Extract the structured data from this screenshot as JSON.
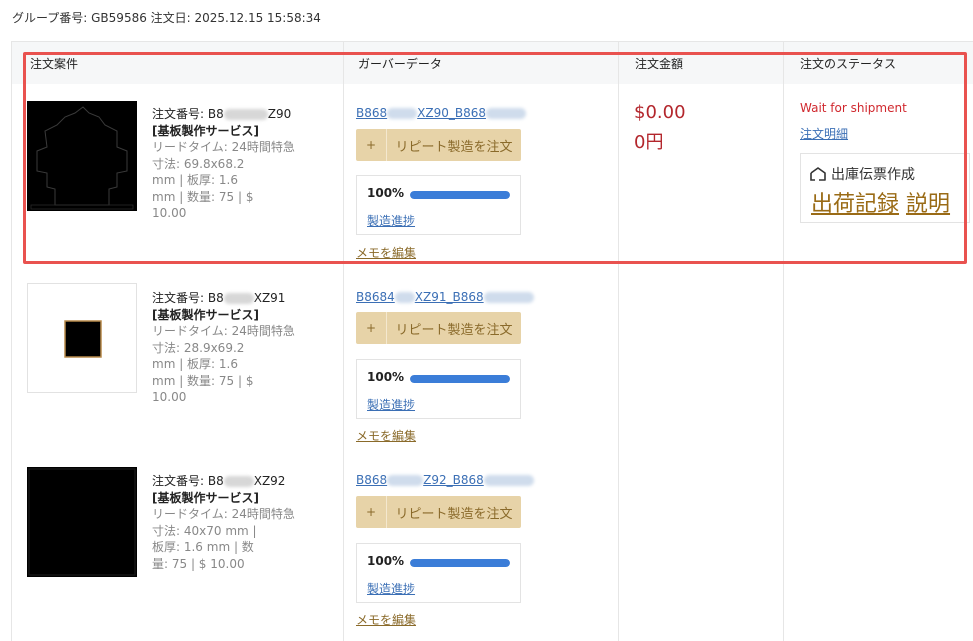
{
  "group": {
    "label": "グループ番号: GB59586 注文日: 2025.12.15 15:58:34"
  },
  "headers": {
    "case": "注文案件",
    "gerber": "ガーバーデータ",
    "amount": "注文金額",
    "status": "注文のステータス"
  },
  "items": [
    {
      "order_prefix": "注文番号: B8",
      "order_suffix": "Z90",
      "service": "[基板製作サービス]",
      "details": [
        "リードタイム: 24時間特急",
        "寸法: 69.8x68.2",
        "mm | 板厚: 1.6",
        "mm | 数量: 75 | $",
        "10.00"
      ],
      "gerber_prefix": "B868",
      "gerber_mid": "XZ90_B868",
      "repeat_plus": "+",
      "repeat_label": "リピート製造を注文",
      "progress_pct": "100%",
      "progress_value": 100,
      "progress_link": "製造進捗",
      "memo": "メモを編集"
    },
    {
      "order_prefix": "注文番号: B8",
      "order_suffix": "XZ91",
      "service": "[基板製作サービス]",
      "details": [
        "リードタイム: 24時間特急",
        "寸法: 28.9x69.2",
        "mm | 板厚: 1.6",
        "mm | 数量: 75 | $",
        "10.00"
      ],
      "gerber_prefix": "B8684",
      "gerber_mid": "XZ91_B868",
      "repeat_plus": "+",
      "repeat_label": "リピート製造を注文",
      "progress_pct": "100%",
      "progress_value": 100,
      "progress_link": "製造進捗",
      "memo": "メモを編集"
    },
    {
      "order_prefix": "注文番号: B8",
      "order_suffix": "XZ92",
      "service": "[基板製作サービス]",
      "details": [
        "リードタイム: 24時間特急",
        "寸法: 40x70 mm |",
        "板厚: 1.6 mm | 数",
        "量: 75 | $ 10.00"
      ],
      "gerber_prefix": "B868",
      "gerber_mid": "Z92_B868",
      "repeat_plus": "+",
      "repeat_label": "リピート製造を注文",
      "progress_pct": "100%",
      "progress_value": 100,
      "progress_link": "製造進捗",
      "memo": "メモを編集"
    }
  ],
  "order": {
    "amount_usd": "$0.00",
    "amount_jpy": "0円",
    "status": "Wait for shipment",
    "detail_link": "注文明細",
    "shipping_title": "出庫伝票作成",
    "shipping_record": "出荷記録",
    "shipping_explain": "説明"
  },
  "colors": {
    "highlight": "#e9524f",
    "link": "#3b6fb5",
    "gold": "#e7d3a8",
    "price": "#b3262c",
    "progress": "#3b7dd8"
  }
}
